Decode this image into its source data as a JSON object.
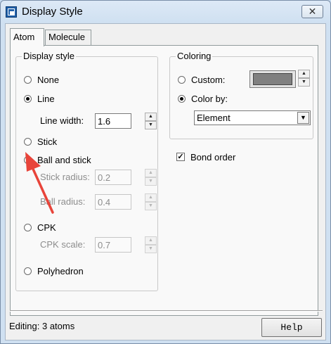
{
  "window": {
    "title": "Display Style",
    "close_glyph": "✕"
  },
  "tabs": [
    {
      "label": "Atom",
      "active": true
    },
    {
      "label": "Molecule",
      "active": false
    }
  ],
  "display_style": {
    "legend": "Display style",
    "options": {
      "none": "None",
      "line": "Line",
      "stick": "Stick",
      "ball_and_stick": "Ball and stick",
      "cpk": "CPK",
      "polyhedron": "Polyhedron"
    },
    "selected": "Line",
    "line_width": {
      "label": "Line width:",
      "value": "1.6"
    },
    "stick_radius": {
      "label": "Stick radius:",
      "value": "0.2"
    },
    "ball_radius": {
      "label": "Ball radius:",
      "value": "0.4"
    },
    "cpk_scale": {
      "label": "CPK scale:",
      "value": "0.7"
    }
  },
  "coloring": {
    "legend": "Coloring",
    "custom_label": "Custom:",
    "color_by_label": "Color by:",
    "selected": "Color by",
    "custom_color": "#808080",
    "color_by_value": "Element"
  },
  "bond_order": {
    "label": "Bond order",
    "checked": true
  },
  "status": {
    "text": "Editing: 3 atoms"
  },
  "help_button": {
    "label": "Help"
  },
  "annotation": {
    "arrow_color": "#e8443a"
  },
  "icons": [
    "app-icon",
    "close-icon",
    "spin-up-icon",
    "spin-down-icon",
    "dropdown-arrow-icon",
    "annotation-arrow"
  ]
}
